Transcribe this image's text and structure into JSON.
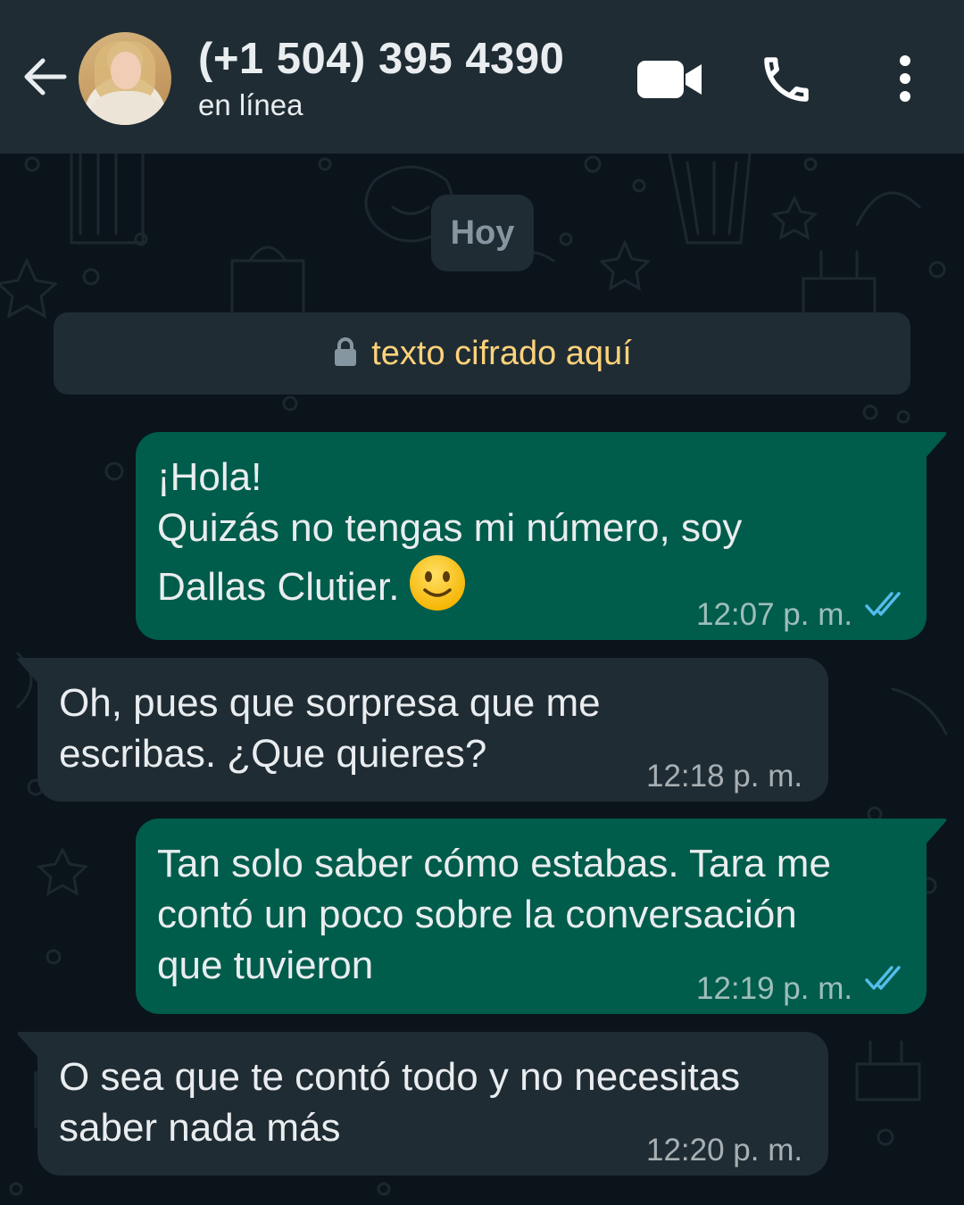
{
  "header": {
    "contact_name": "(+1 504) 395 4390",
    "status": "en línea",
    "icons": [
      "back-arrow-icon",
      "avatar",
      "video-call-icon",
      "phone-icon",
      "more-vert-icon"
    ]
  },
  "chat": {
    "date_chip": "Hoy",
    "encryption_notice": "texto cifrado aquí",
    "messages": [
      {
        "direction": "outgoing",
        "text": "¡Hola!\nQuizás no tengas mi número, soy\nDallas Clutier.",
        "emoji": "slightly-smiling-face",
        "time": "12:07 p. m.",
        "status": "read"
      },
      {
        "direction": "incoming",
        "text": "Oh, pues que sorpresa que me\nescribas. ¿Que quieres?",
        "time": "12:18 p. m."
      },
      {
        "direction": "outgoing",
        "text": "Tan solo saber cómo estabas. Tara me\ncontó un poco sobre la conversación\nque tuvieron",
        "time": "12:19 p. m.",
        "status": "read"
      },
      {
        "direction": "incoming",
        "text": "O sea que te contó todo y no necesitas\nsaber nada más",
        "time": "12:20 p. m."
      }
    ]
  },
  "colors": {
    "header_bg": "#1f2c34",
    "chat_bg": "#0b141a",
    "outgoing_bubble": "#005c4b",
    "incoming_bubble": "#202c33",
    "read_ticks": "#53bdeb",
    "encryption_text": "#ffd279"
  }
}
